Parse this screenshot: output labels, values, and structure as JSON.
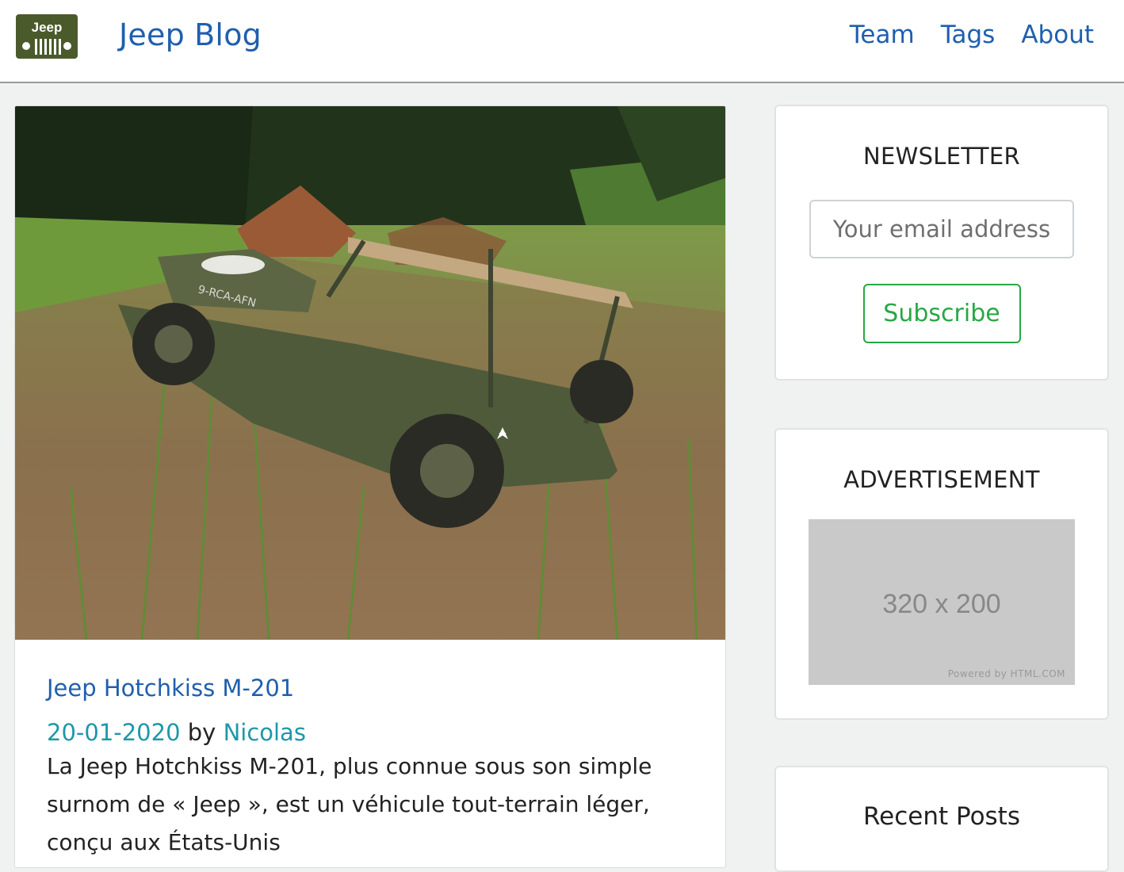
{
  "navbar": {
    "logo_text": "Jeep",
    "brand": "Jeep Blog",
    "links": [
      "Team",
      "Tags",
      "About"
    ]
  },
  "post": {
    "title": "Jeep Hotchkiss M-201",
    "date": "20-01-2020",
    "by": "by",
    "author": "Nicolas",
    "excerpt": "La Jeep Hotchkiss M-201, plus connue sous son simple surnom de « Jeep », est un véhicule tout-terrain léger, conçu aux États-Unis",
    "image_text": "9-RCA-AFN"
  },
  "sidebar": {
    "newsletter": {
      "title": "NEWSLETTER",
      "placeholder": "Your email address",
      "button": "Subscribe"
    },
    "ad": {
      "title": "ADVERTISEMENT",
      "size_label": "320 x 200",
      "powered_by": "Powered by HTML.COM"
    },
    "recent": {
      "title": "Recent Posts"
    }
  },
  "colors": {
    "link": "#1f5fae",
    "meta_link": "#1d98aa",
    "subscribe_green": "#28a745",
    "logo_green": "#4a5a2a"
  }
}
